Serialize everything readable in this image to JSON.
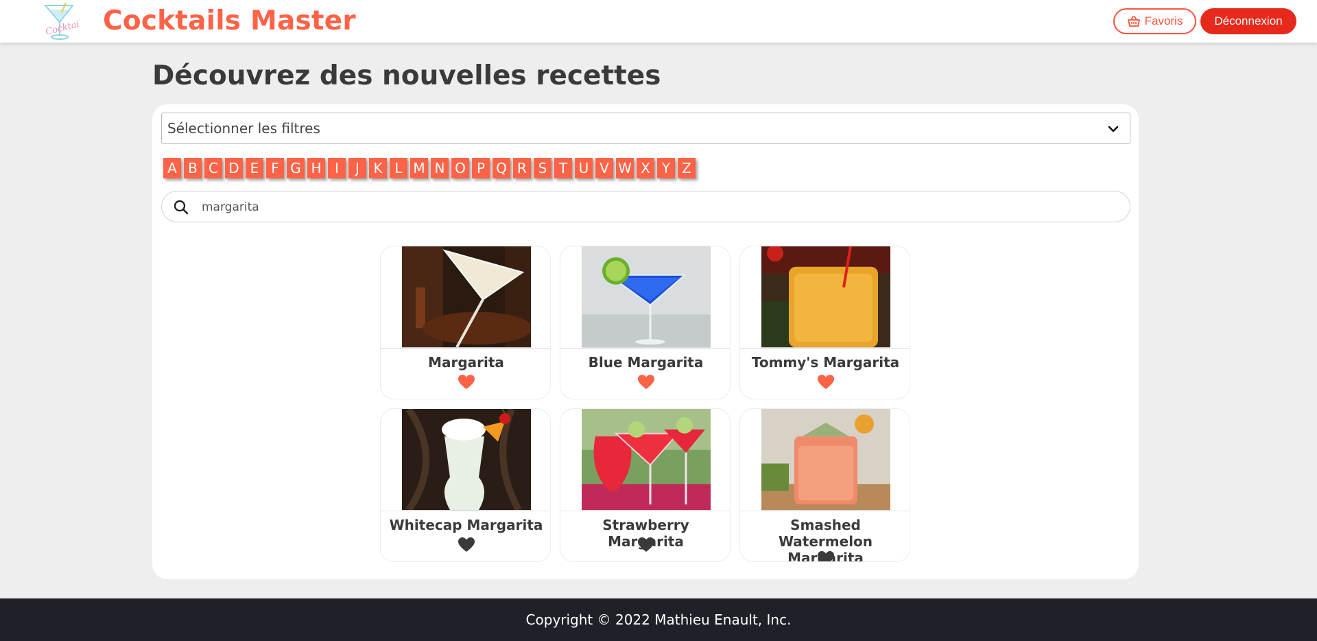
{
  "header": {
    "brand": "Cocktails Master",
    "logo_text": "Cocktails",
    "favorites_label": "Favoris",
    "logout_label": "Déconnexion"
  },
  "page": {
    "title": "Découvrez des nouvelles recettes"
  },
  "filters": {
    "select_label": "Sélectionner les filtres"
  },
  "alphabet": [
    "A",
    "B",
    "C",
    "D",
    "E",
    "F",
    "G",
    "H",
    "I",
    "J",
    "K",
    "L",
    "M",
    "N",
    "O",
    "P",
    "Q",
    "R",
    "S",
    "T",
    "U",
    "V",
    "W",
    "X",
    "Y",
    "Z"
  ],
  "search": {
    "value": "margarita"
  },
  "cocktails": [
    {
      "name": "Margarita",
      "favorite": true
    },
    {
      "name": "Blue Margarita",
      "favorite": true
    },
    {
      "name": "Tommy's Margarita",
      "favorite": true
    },
    {
      "name": "Whitecap Margarita",
      "favorite": false
    },
    {
      "name": "Strawberry Margarita",
      "favorite": false
    },
    {
      "name": "Smashed Watermelon Margarita",
      "favorite": false
    }
  ],
  "colors": {
    "accent": "#ff6347",
    "logout": "#e6291b",
    "heart_active": "#ff6347",
    "heart_inactive": "#3a3a3a",
    "footer": "#1f2128"
  },
  "footer": {
    "copyright": "Copyright © 2022 Mathieu Enault, Inc."
  }
}
